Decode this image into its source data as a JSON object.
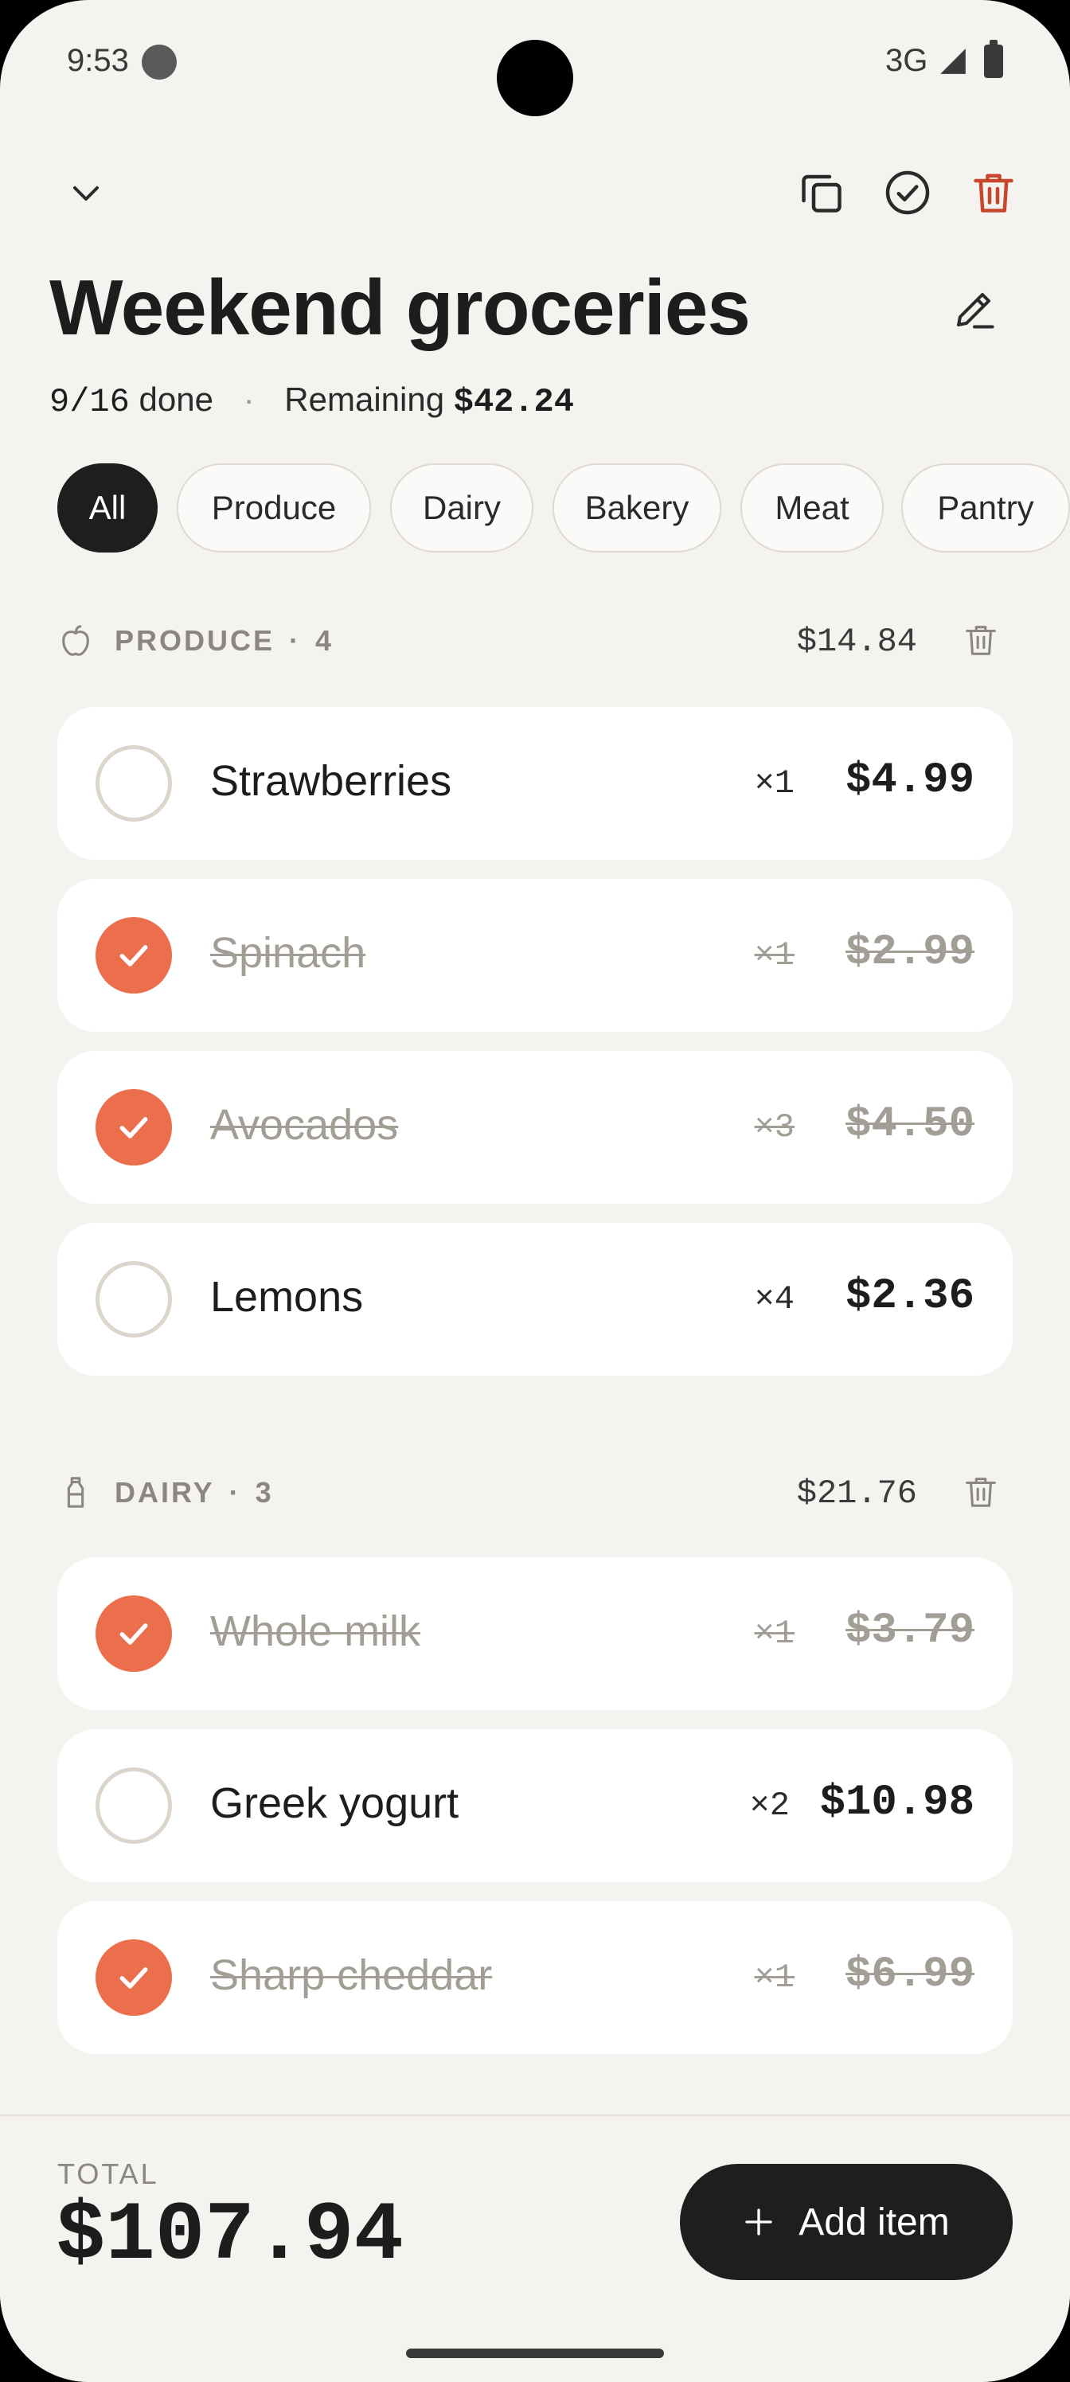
{
  "status_bar": {
    "time": "9:53",
    "network": "3G"
  },
  "header": {
    "title": "Weekend groceries",
    "progress_text": "9/16",
    "done_word": "done",
    "separator": "·",
    "remaining_label": "Remaining",
    "remaining_value": "$42.24"
  },
  "filters": [
    "All",
    "Produce",
    "Dairy",
    "Bakery",
    "Meat",
    "Pantry"
  ],
  "sections": [
    {
      "label": "PRODUCE",
      "count": "4",
      "total": "$14.84",
      "icon": "apple-icon",
      "items": [
        {
          "name": "Strawberries",
          "qty": "×1",
          "price": "$4.99",
          "checked": false
        },
        {
          "name": "Spinach",
          "qty": "×1",
          "price": "$2.99",
          "checked": true
        },
        {
          "name": "Avocados",
          "qty": "×3",
          "price": "$4.50",
          "checked": true
        },
        {
          "name": "Lemons",
          "qty": "×4",
          "price": "$2.36",
          "checked": false
        }
      ]
    },
    {
      "label": "DAIRY",
      "count": "3",
      "total": "$21.76",
      "icon": "bottle-icon",
      "items": [
        {
          "name": "Whole milk",
          "qty": "×1",
          "price": "$3.79",
          "checked": true
        },
        {
          "name": "Greek yogurt",
          "qty": "×2",
          "price": "$10.98",
          "checked": false
        },
        {
          "name": "Sharp cheddar",
          "qty": "×1",
          "price": "$6.99",
          "checked": true
        }
      ]
    }
  ],
  "footer": {
    "total_label": "TOTAL",
    "total_value": "$107.94",
    "add_label": "Add item"
  },
  "colors": {
    "accent": "#EB6F4C",
    "delete": "#C8452E",
    "background": "#F5F3EF",
    "dark": "#1E1E1E"
  }
}
